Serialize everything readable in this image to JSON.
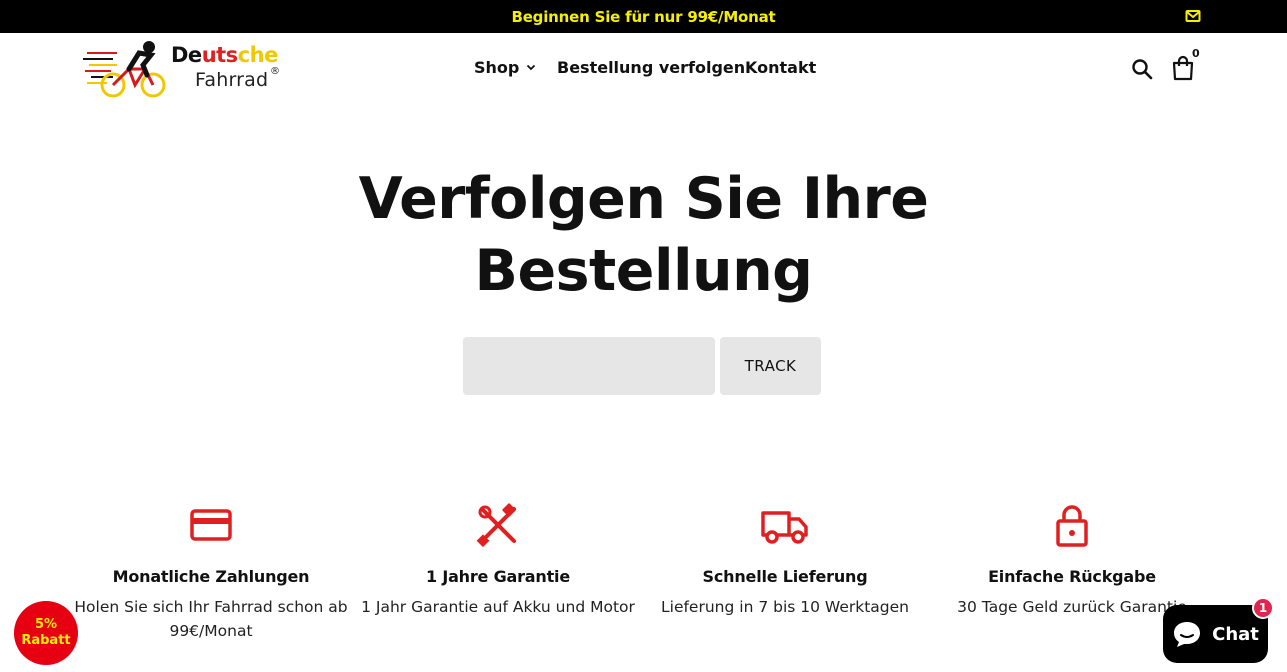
{
  "announcement": {
    "text": "Beginnen Sie für nur 99€/Monat"
  },
  "logo": {
    "word_top": [
      "De",
      "uts",
      "che"
    ],
    "word_bottom": "Fahrrad",
    "reg": "®"
  },
  "nav": {
    "shop": "Shop",
    "track": "Bestellung verfolgen",
    "contact": "Kontakt"
  },
  "cart": {
    "count": "0"
  },
  "hero": {
    "line1": "Verfolgen Sie Ihre",
    "line2": "Bestellung"
  },
  "tracking": {
    "input_value": "",
    "button_label": "TRACK"
  },
  "features": [
    {
      "icon": "credit-card-icon",
      "title": "Monatliche Zahlungen",
      "text": "Holen Sie sich Ihr Fahrrad schon ab 99€/Monat"
    },
    {
      "icon": "tools-icon",
      "title": "1 Jahre Garantie",
      "text": "1 Jahr Garantie auf Akku und Motor"
    },
    {
      "icon": "truck-icon",
      "title": "Schnelle Lieferung",
      "text": "Lieferung in 7 bis 10 Werktagen"
    },
    {
      "icon": "lock-icon",
      "title": "Einfache Rückgabe",
      "text": "30 Tage Geld zurück Garantie"
    }
  ],
  "discount_badge": {
    "line1": "5%",
    "line2": "Rabatt"
  },
  "chat": {
    "label": "Chat",
    "unread": "1"
  },
  "colors": {
    "accent_red": "#e02020",
    "promo_yellow": "#f6f000",
    "badge_red": "#e60012"
  }
}
